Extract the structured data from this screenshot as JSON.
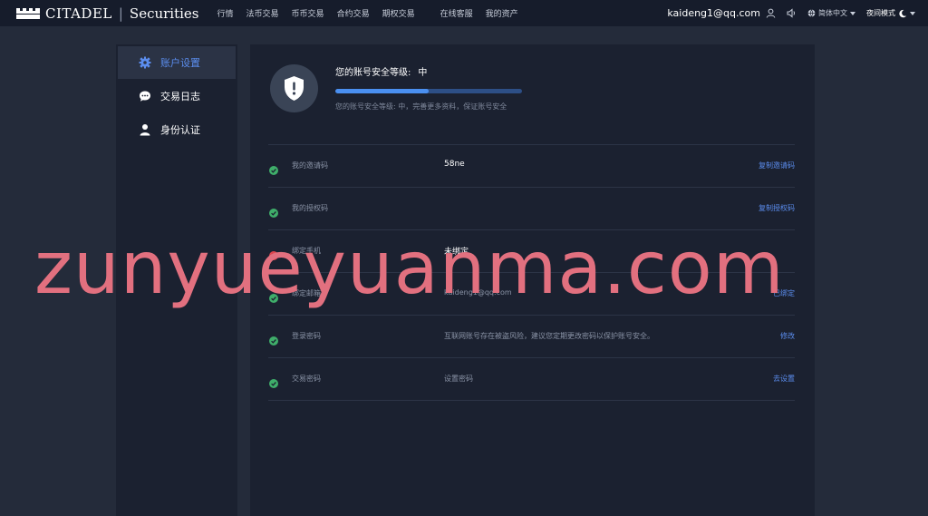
{
  "header": {
    "logo_text": "CITADEL",
    "logo_separator": "|",
    "logo_text2": "Securities",
    "nav_items": [
      "行情",
      "法币交易",
      "币币交易",
      "合约交易",
      "期权交易"
    ],
    "nav_items_right": [
      "在线客服",
      "我的资产"
    ],
    "user_email": "kaideng1@qq.com",
    "language": "简体中文",
    "night_mode": "夜间模式"
  },
  "sidebar": {
    "items": [
      {
        "label": "账户设置",
        "icon": "gear-icon",
        "active": true
      },
      {
        "label": "交易日志",
        "icon": "chat-bubble-icon",
        "active": false
      },
      {
        "label": "身份认证",
        "icon": "person-icon",
        "active": false
      }
    ]
  },
  "security": {
    "title": "您的账号安全等级:",
    "level": "中",
    "progress": 0.5,
    "description": "您的账号安全等级: 中，完善更多资料，保证账号安全"
  },
  "rows": [
    {
      "status": "ok",
      "label": "我的邀请码",
      "value": "58ne",
      "action": "复制邀请码"
    },
    {
      "status": "ok",
      "label": "我的授权码",
      "value": "",
      "action": "复制授权码"
    },
    {
      "status": "error",
      "label": "绑定手机",
      "value": "未绑定",
      "action": ""
    },
    {
      "status": "ok",
      "label": "绑定邮箱",
      "value": "kaideng1@qq.com",
      "action": "已绑定"
    },
    {
      "status": "ok",
      "label": "登录密码",
      "value": "互联网账号存在被盗风险，建议您定期更改密码以保护账号安全。",
      "action": "修改"
    },
    {
      "status": "ok",
      "label": "交易密码",
      "value": "设置密码",
      "action": "去设置"
    }
  ],
  "colors": {
    "accent": "#5b8dee",
    "ok": "#3fae6a",
    "error": "#e0464e",
    "background": "#242b3a",
    "panel": "#1b2130"
  },
  "watermark": "zunyueyuanma.com"
}
